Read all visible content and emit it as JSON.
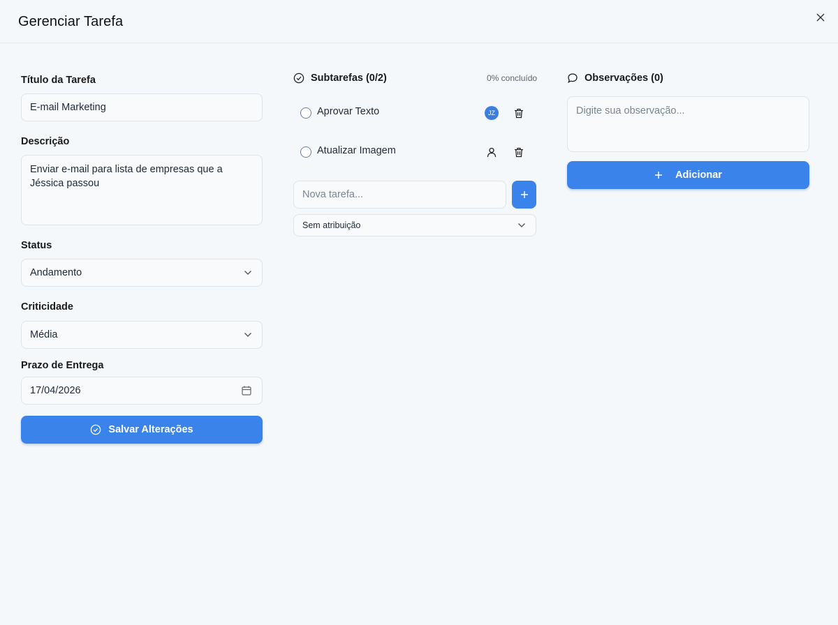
{
  "header": {
    "title": "Gerenciar Tarefa"
  },
  "form": {
    "title_label": "Título da Tarefa",
    "title_value": "E-mail Marketing",
    "description_label": "Descrição",
    "description_value": "Enviar e-mail para lista de empresas que a Jéssica passou",
    "status_label": "Status",
    "status_value": "Andamento",
    "criticality_label": "Criticidade",
    "criticality_value": "Média",
    "deadline_label": "Prazo de Entrega",
    "deadline_value": "17/04/2026",
    "save_label": "Salvar Alterações"
  },
  "subtasks": {
    "heading": "Subtarefas (0/2)",
    "progress": "0% concluído",
    "items": [
      {
        "label": "Aprovar Texto",
        "assignee": "JZ"
      },
      {
        "label": "Atualizar Imagem",
        "assignee": ""
      }
    ],
    "new_placeholder": "Nova tarefa...",
    "assign_value": "Sem atribuição"
  },
  "notes": {
    "heading": "Observações (0)",
    "placeholder": "Digite sua observação...",
    "add_label": "Adicionar"
  },
  "colors": {
    "primary": "#3a83ea",
    "background": "#f5f8fa",
    "border": "#dde3ea"
  },
  "icons": [
    "close-icon",
    "check-circle-icon",
    "chevron-down-icon",
    "calendar-icon",
    "trash-icon",
    "user-icon",
    "plus-icon",
    "comment-icon"
  ]
}
